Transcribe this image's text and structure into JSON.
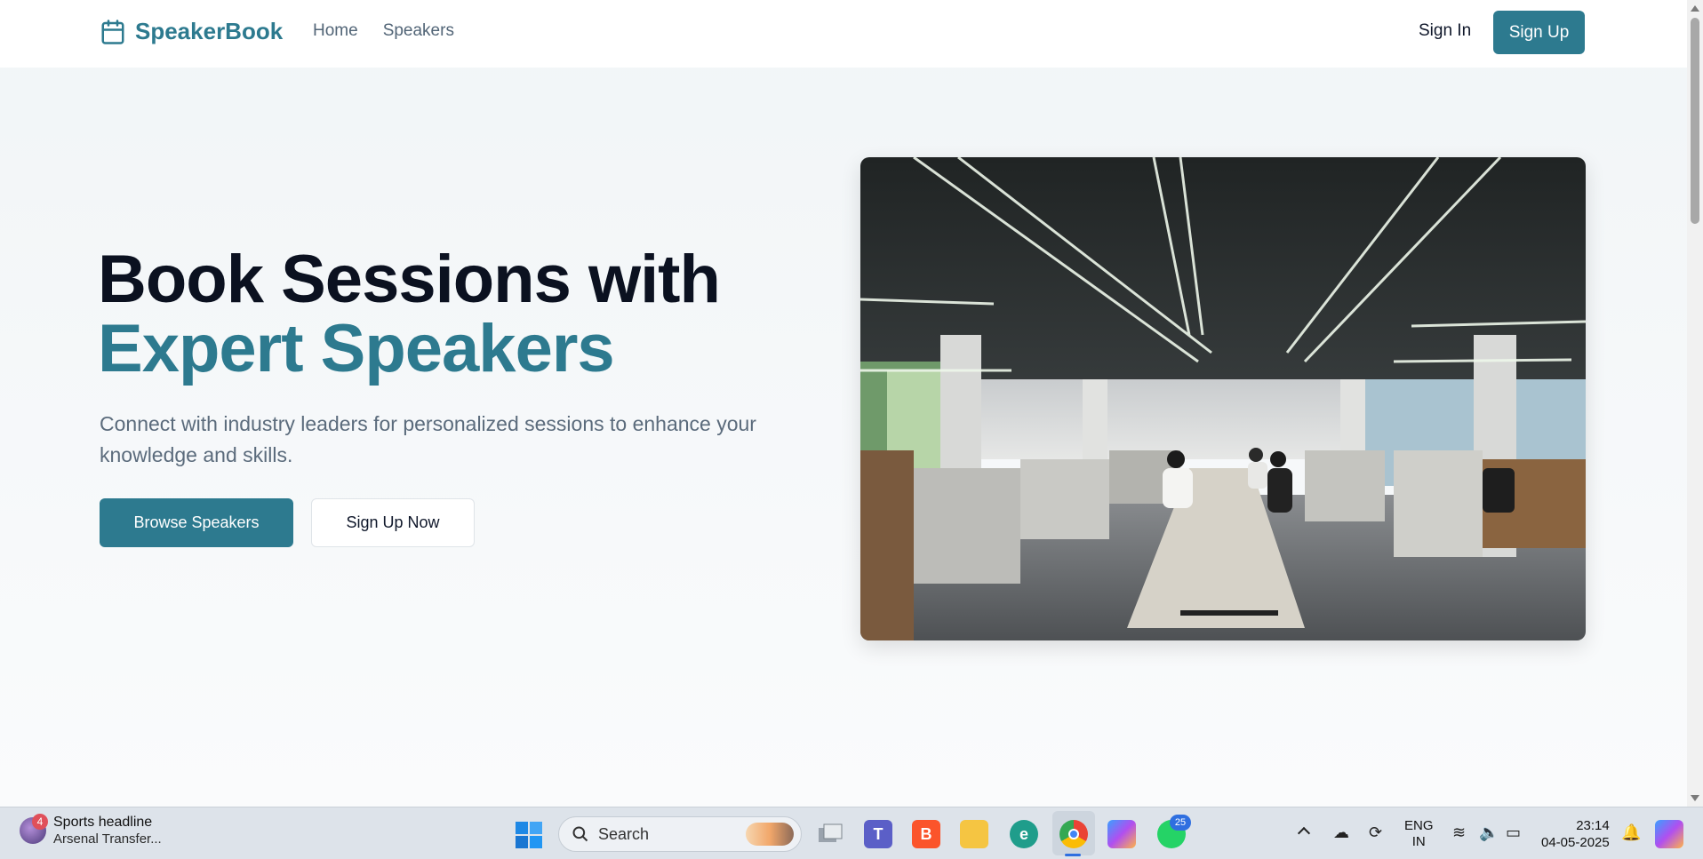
{
  "header": {
    "brand": "SpeakerBook",
    "nav": [
      "Home",
      "Speakers"
    ],
    "sign_in": "Sign In",
    "sign_up": "Sign Up"
  },
  "hero": {
    "title_line1": "Book Sessions with",
    "title_line2": "Expert Speakers",
    "subtitle": "Connect with industry leaders for personalized sessions to enhance your knowledge and skills.",
    "primary_button": "Browse Speakers",
    "secondary_button": "Sign Up Now",
    "image_icon": "office-photo"
  },
  "colors": {
    "accent": "#2d7a8f",
    "heading": "#0b1120",
    "muted": "#5b6b7c"
  },
  "taskbar": {
    "widget_badge": "4",
    "widget_title": "Sports headline",
    "widget_subtitle": "Arsenal Transfer...",
    "search_label": "Search",
    "whatsapp_badge": "25",
    "lang_line1": "ENG",
    "lang_line2": "IN",
    "time": "23:14",
    "date": "04-05-2025",
    "icons": [
      "start-icon",
      "task-view-icon",
      "teams-icon",
      "brave-icon",
      "file-explorer-icon",
      "edge-icon",
      "chrome-icon",
      "copilot-icon",
      "whatsapp-icon"
    ]
  }
}
